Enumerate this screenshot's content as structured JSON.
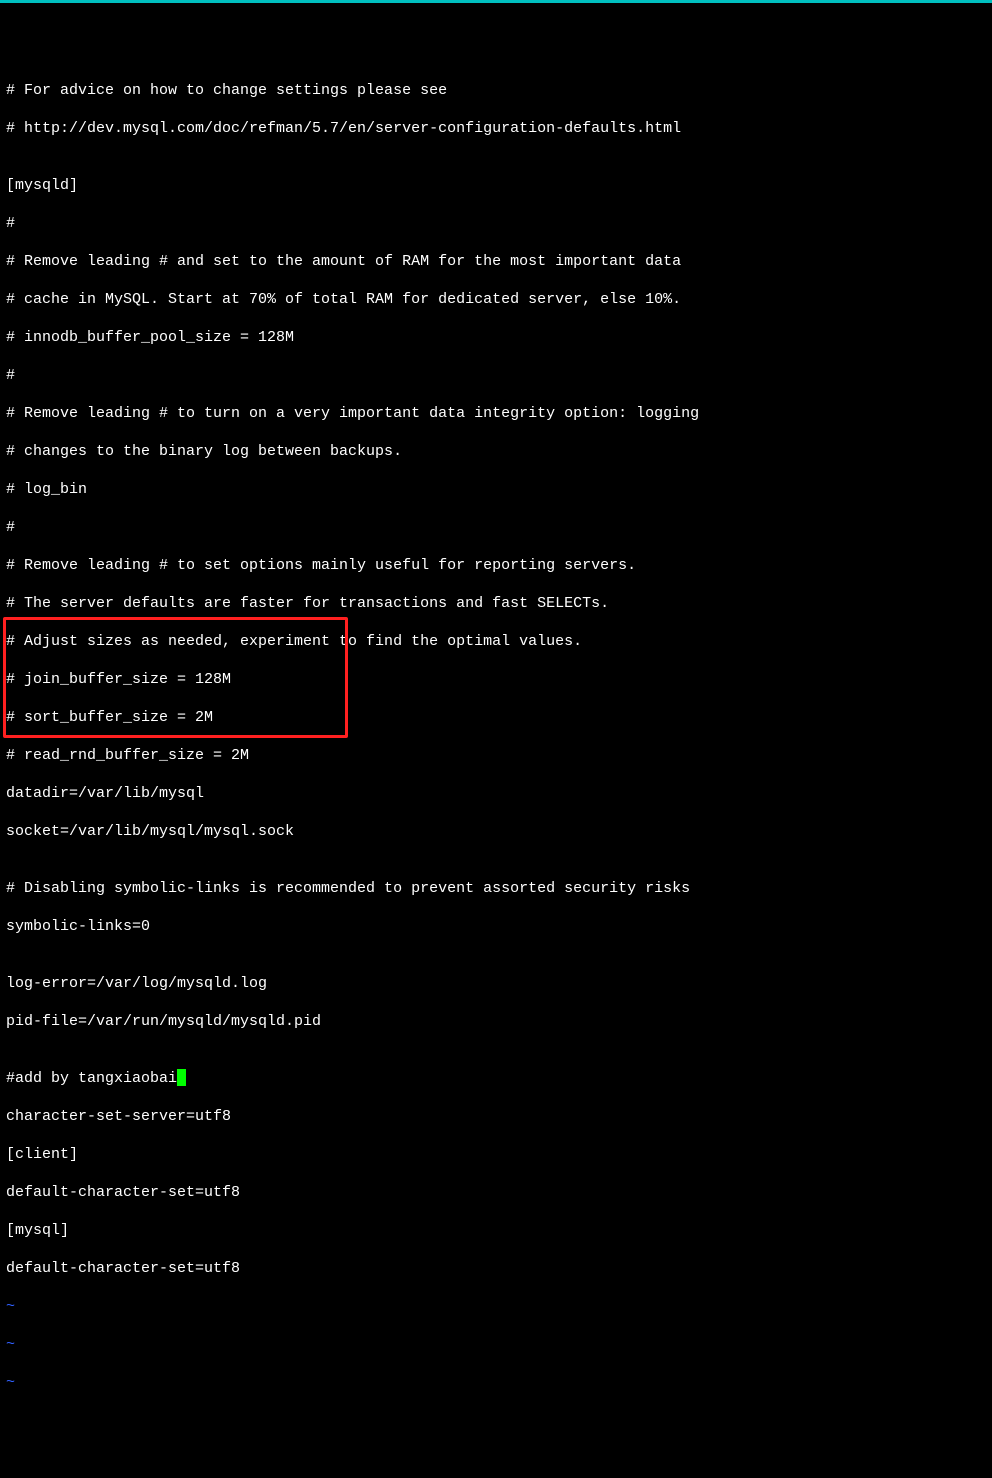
{
  "lines": {
    "l0": "# For advice on how to change settings please see",
    "l1": "# http://dev.mysql.com/doc/refman/5.7/en/server-configuration-defaults.html",
    "l2": "",
    "l3": "[mysqld]",
    "l4": "#",
    "l5": "# Remove leading # and set to the amount of RAM for the most important data",
    "l6": "# cache in MySQL. Start at 70% of total RAM for dedicated server, else 10%.",
    "l7": "# innodb_buffer_pool_size = 128M",
    "l8": "#",
    "l9": "# Remove leading # to turn on a very important data integrity option: logging",
    "l10": "# changes to the binary log between backups.",
    "l11": "# log_bin",
    "l12": "#",
    "l13": "# Remove leading # to set options mainly useful for reporting servers.",
    "l14": "# The server defaults are faster for transactions and fast SELECTs.",
    "l15": "# Adjust sizes as needed, experiment to find the optimal values.",
    "l16": "# join_buffer_size = 128M",
    "l17": "# sort_buffer_size = 2M",
    "l18": "# read_rnd_buffer_size = 2M",
    "l19": "datadir=/var/lib/mysql",
    "l20": "socket=/var/lib/mysql/mysql.sock",
    "l21": "",
    "l22": "# Disabling symbolic-links is recommended to prevent assorted security risks",
    "l23": "symbolic-links=0",
    "l24": "",
    "l25": "log-error=/var/log/mysqld.log",
    "l26": "pid-file=/var/run/mysqld/mysqld.pid",
    "l27": "",
    "l28": "#add by tangxiaobai",
    "l29": "character-set-server=utf8",
    "l30": "[client]",
    "l31": "default-character-set=utf8",
    "l32": "[mysql]",
    "l33": "default-character-set=utf8",
    "tilde": "~"
  }
}
